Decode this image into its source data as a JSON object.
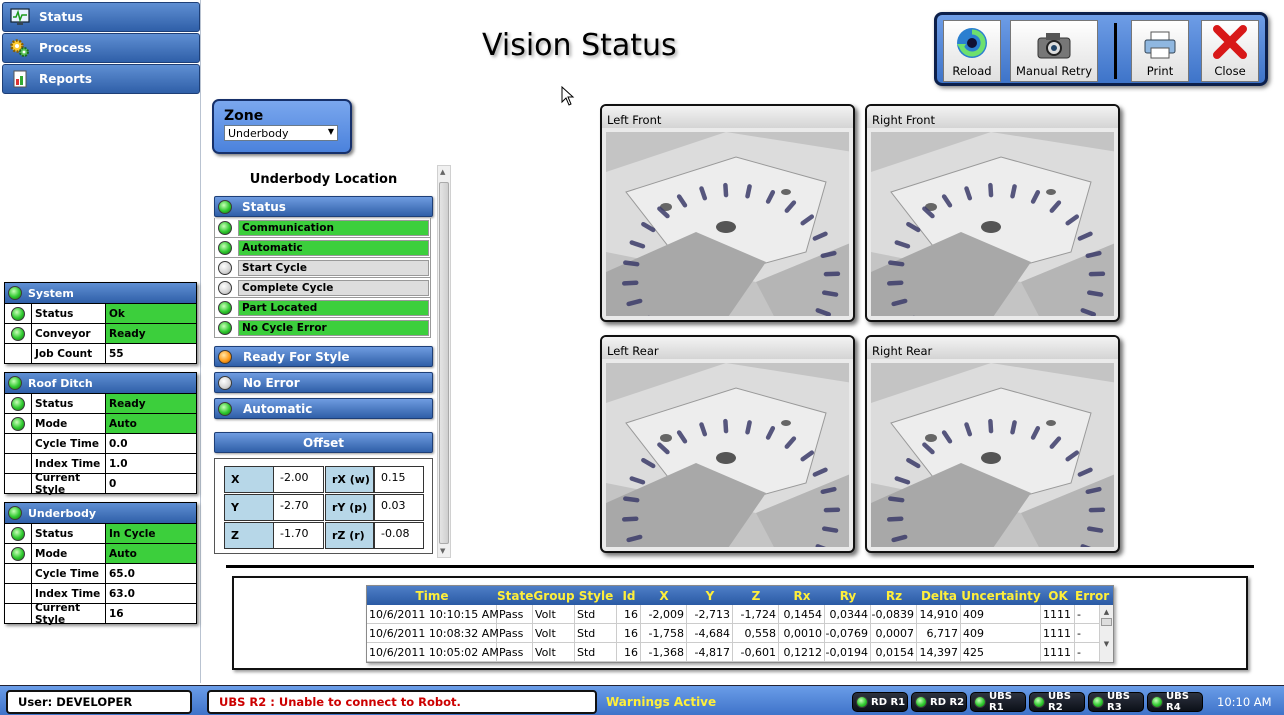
{
  "nav": {
    "status": "Status",
    "process": "Process",
    "reports": "Reports"
  },
  "page_title": "Vision Status",
  "toolbar": {
    "reload": "Reload",
    "manual_retry": "Manual Retry",
    "print": "Print",
    "close": "Close"
  },
  "system": {
    "title": "System",
    "rows": [
      {
        "label": "Status",
        "value": "Ok",
        "led": "green",
        "highlight": true
      },
      {
        "label": "Conveyor",
        "value": "Ready",
        "led": "green",
        "highlight": true
      },
      {
        "label": "Job Count",
        "value": "55",
        "led": "none",
        "highlight": false
      }
    ]
  },
  "roof_ditch": {
    "title": "Roof Ditch",
    "rows": [
      {
        "label": "Status",
        "value": "Ready",
        "led": "green",
        "highlight": true
      },
      {
        "label": "Mode",
        "value": "Auto",
        "led": "green",
        "highlight": true
      },
      {
        "label": "Cycle Time",
        "value": "0.0",
        "led": "none",
        "highlight": false
      },
      {
        "label": "Index Time",
        "value": "1.0",
        "led": "none",
        "highlight": false
      },
      {
        "label": "Current Style",
        "value": "0",
        "led": "none",
        "highlight": false
      }
    ]
  },
  "underbody": {
    "title": "Underbody",
    "rows": [
      {
        "label": "Status",
        "value": "In Cycle",
        "led": "green",
        "highlight": true
      },
      {
        "label": "Mode",
        "value": "Auto",
        "led": "green",
        "highlight": true
      },
      {
        "label": "Cycle Time",
        "value": "65.0",
        "led": "none",
        "highlight": false
      },
      {
        "label": "Index Time",
        "value": "63.0",
        "led": "none",
        "highlight": false
      },
      {
        "label": "Current Style",
        "value": "16",
        "led": "none",
        "highlight": false
      }
    ]
  },
  "zone": {
    "label": "Zone",
    "selected": "Underbody"
  },
  "location_title": "Underbody Location",
  "status_header": "Status",
  "status_items": [
    {
      "label": "Communication",
      "active": true
    },
    {
      "label": "Automatic",
      "active": true
    },
    {
      "label": "Start Cycle",
      "active": false
    },
    {
      "label": "Complete Cycle",
      "active": false
    },
    {
      "label": "Part Located",
      "active": true
    },
    {
      "label": "No Cycle Error",
      "active": true
    }
  ],
  "indicators": {
    "ready_for_style": "Ready For Style",
    "no_error": "No Error",
    "automatic": "Automatic"
  },
  "offset": {
    "title": "Offset",
    "x_label": "X",
    "x": "-2.00",
    "rx_label": "rX (w)",
    "rx": "0.15",
    "y_label": "Y",
    "y": "-2.70",
    "ry_label": "rY (p)",
    "ry": "0.03",
    "z_label": "Z",
    "z": "-1.70",
    "rz_label": "rZ (r)",
    "rz": "-0.08"
  },
  "cameras": {
    "left_front": "Left Front",
    "right_front": "Right Front",
    "left_rear": "Left Rear",
    "right_rear": "Right Rear"
  },
  "log": {
    "columns": [
      "Time",
      "State",
      "Group",
      "Style",
      "Id",
      "X",
      "Y",
      "Z",
      "Rx",
      "Ry",
      "Rz",
      "Delta",
      "Uncertainty",
      "OK",
      "Error"
    ],
    "rows": [
      [
        "10/6/2011 10:10:15 AM",
        "Pass",
        "Volt",
        "Std",
        "16",
        "-2,009",
        "-2,713",
        "-1,724",
        "0,1454",
        "0,0344",
        "-0,0839",
        "14,910",
        "409",
        "1111",
        "-"
      ],
      [
        "10/6/2011 10:08:32 AM",
        "Pass",
        "Volt",
        "Std",
        "16",
        "-1,758",
        "-4,684",
        "0,558",
        "0,0010",
        "-0,0769",
        "0,0007",
        "6,717",
        "409",
        "1111",
        "-"
      ],
      [
        "10/6/2011 10:05:02 AM",
        "Pass",
        "Volt",
        "Std",
        "16",
        "-1,368",
        "-4,817",
        "-0,601",
        "0,1212",
        "-0,0194",
        "0,0154",
        "14,397",
        "425",
        "1111",
        "-"
      ]
    ]
  },
  "statusbar": {
    "user": "User:  DEVELOPER",
    "error": "UBS R2 : Unable to connect to Robot.",
    "warnings": "Warnings Active",
    "robots": [
      "RD R1",
      "RD R2",
      "UBS R1",
      "UBS R2",
      "UBS R3",
      "UBS R4"
    ],
    "time": "10:10 AM"
  },
  "colors": {
    "accent": "#3f73c9",
    "active_green": "#3ccf3c",
    "error_red": "#cc0000",
    "warning_yellow": "#ffef3a"
  },
  "icons": {
    "status": "monitor-icon",
    "process": "gears-icon",
    "reports": "report-icon",
    "reload": "reload-icon",
    "manual_retry": "camera-icon",
    "print": "printer-icon",
    "close": "close-icon"
  }
}
